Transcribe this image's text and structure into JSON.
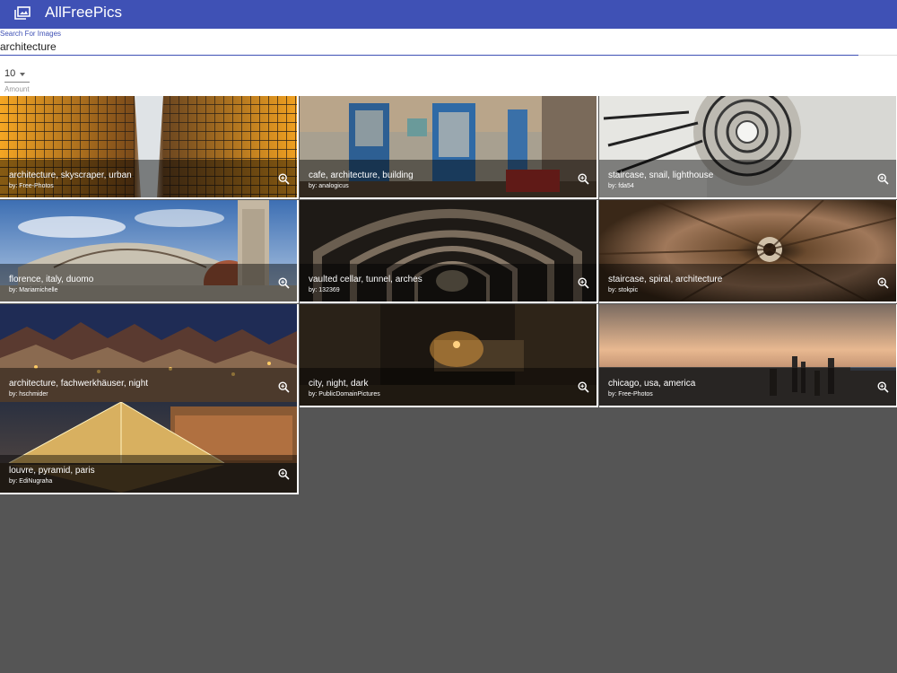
{
  "app": {
    "title": "AllFreePics",
    "logo_icon": "photo-library-icon"
  },
  "search": {
    "label": "Search For Images",
    "value": "architecture"
  },
  "amount": {
    "value": "10",
    "label": "Amount"
  },
  "colors": {
    "primary": "#3f51b5",
    "background": "#555555"
  },
  "images": [
    {
      "tags": "architecture, skyscraper, urban",
      "by": "by: Free-Photos"
    },
    {
      "tags": "cafe, architecture, building",
      "by": "by: analogicus"
    },
    {
      "tags": "staircase, snail, lighthouse",
      "by": "by: fda54"
    },
    {
      "tags": "florence, italy, duomo",
      "by": "by: Mariamichelle"
    },
    {
      "tags": "vaulted cellar, tunnel, arches",
      "by": "by: 132369"
    },
    {
      "tags": "staircase, spiral, architecture",
      "by": "by: stokpic"
    },
    {
      "tags": "architecture, fachwerkhäuser, night",
      "by": "by: hschmider"
    },
    {
      "tags": "city, night, dark",
      "by": "by: PublicDomainPictures"
    },
    {
      "tags": "chicago, usa, america",
      "by": "by: Free-Photos"
    },
    {
      "tags": "louvre, pyramid, paris",
      "by": "by: EdiNugraha"
    }
  ]
}
